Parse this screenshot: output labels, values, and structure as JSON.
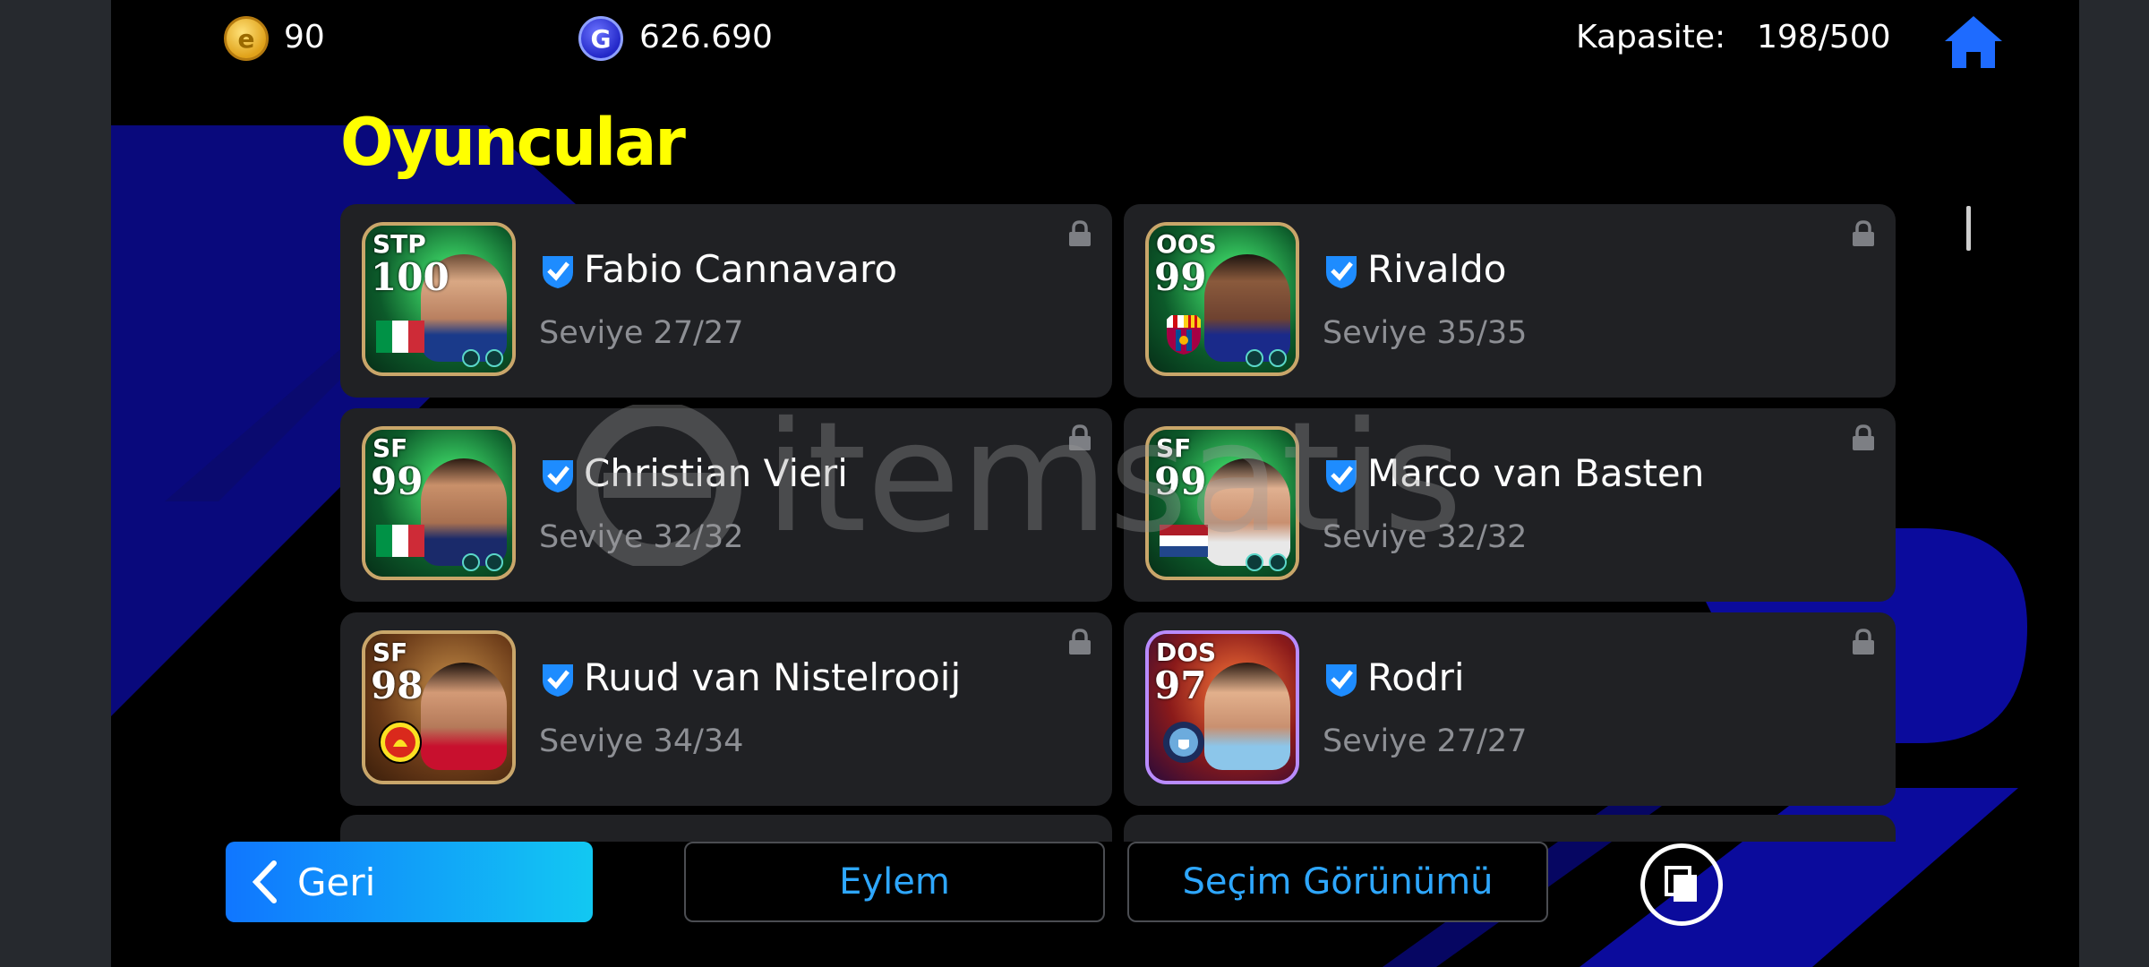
{
  "currency": {
    "efootball_coins": "90",
    "gp": "626.690"
  },
  "capacity": {
    "label": "Kapasite:",
    "value": "198/500"
  },
  "title": "Oyuncular",
  "players": [
    {
      "position": "STP",
      "rating": "100",
      "name": "Fabio Cannavaro",
      "level": "Seviye 27/27",
      "locked": true,
      "badge": "flag-italy"
    },
    {
      "position": "OOS",
      "rating": "99",
      "name": "Rivaldo",
      "level": "Seviye 35/35",
      "locked": true,
      "badge": "club-barcelona"
    },
    {
      "position": "SF",
      "rating": "99",
      "name": "Christian Vieri",
      "level": "Seviye 32/32",
      "locked": true,
      "badge": "flag-italy"
    },
    {
      "position": "SF",
      "rating": "99",
      "name": "Marco van Basten",
      "level": "Seviye 32/32",
      "locked": true,
      "badge": "flag-netherlands"
    },
    {
      "position": "SF",
      "rating": "98",
      "name": "Ruud van Nistelrooij",
      "level": "Seviye 34/34",
      "locked": true,
      "badge": "club-manchester-united"
    },
    {
      "position": "DOS",
      "rating": "97",
      "name": "Rodri",
      "level": "Seviye 27/27",
      "locked": true,
      "badge": "club-manchester-city"
    }
  ],
  "buttons": {
    "back": "Geri",
    "action": "Eylem",
    "selection_view": "Seçim Görünümü"
  },
  "colors": {
    "title_yellow": "#ffff00",
    "accent_blue": "#2ea7ff",
    "card_bg": "#202124"
  }
}
